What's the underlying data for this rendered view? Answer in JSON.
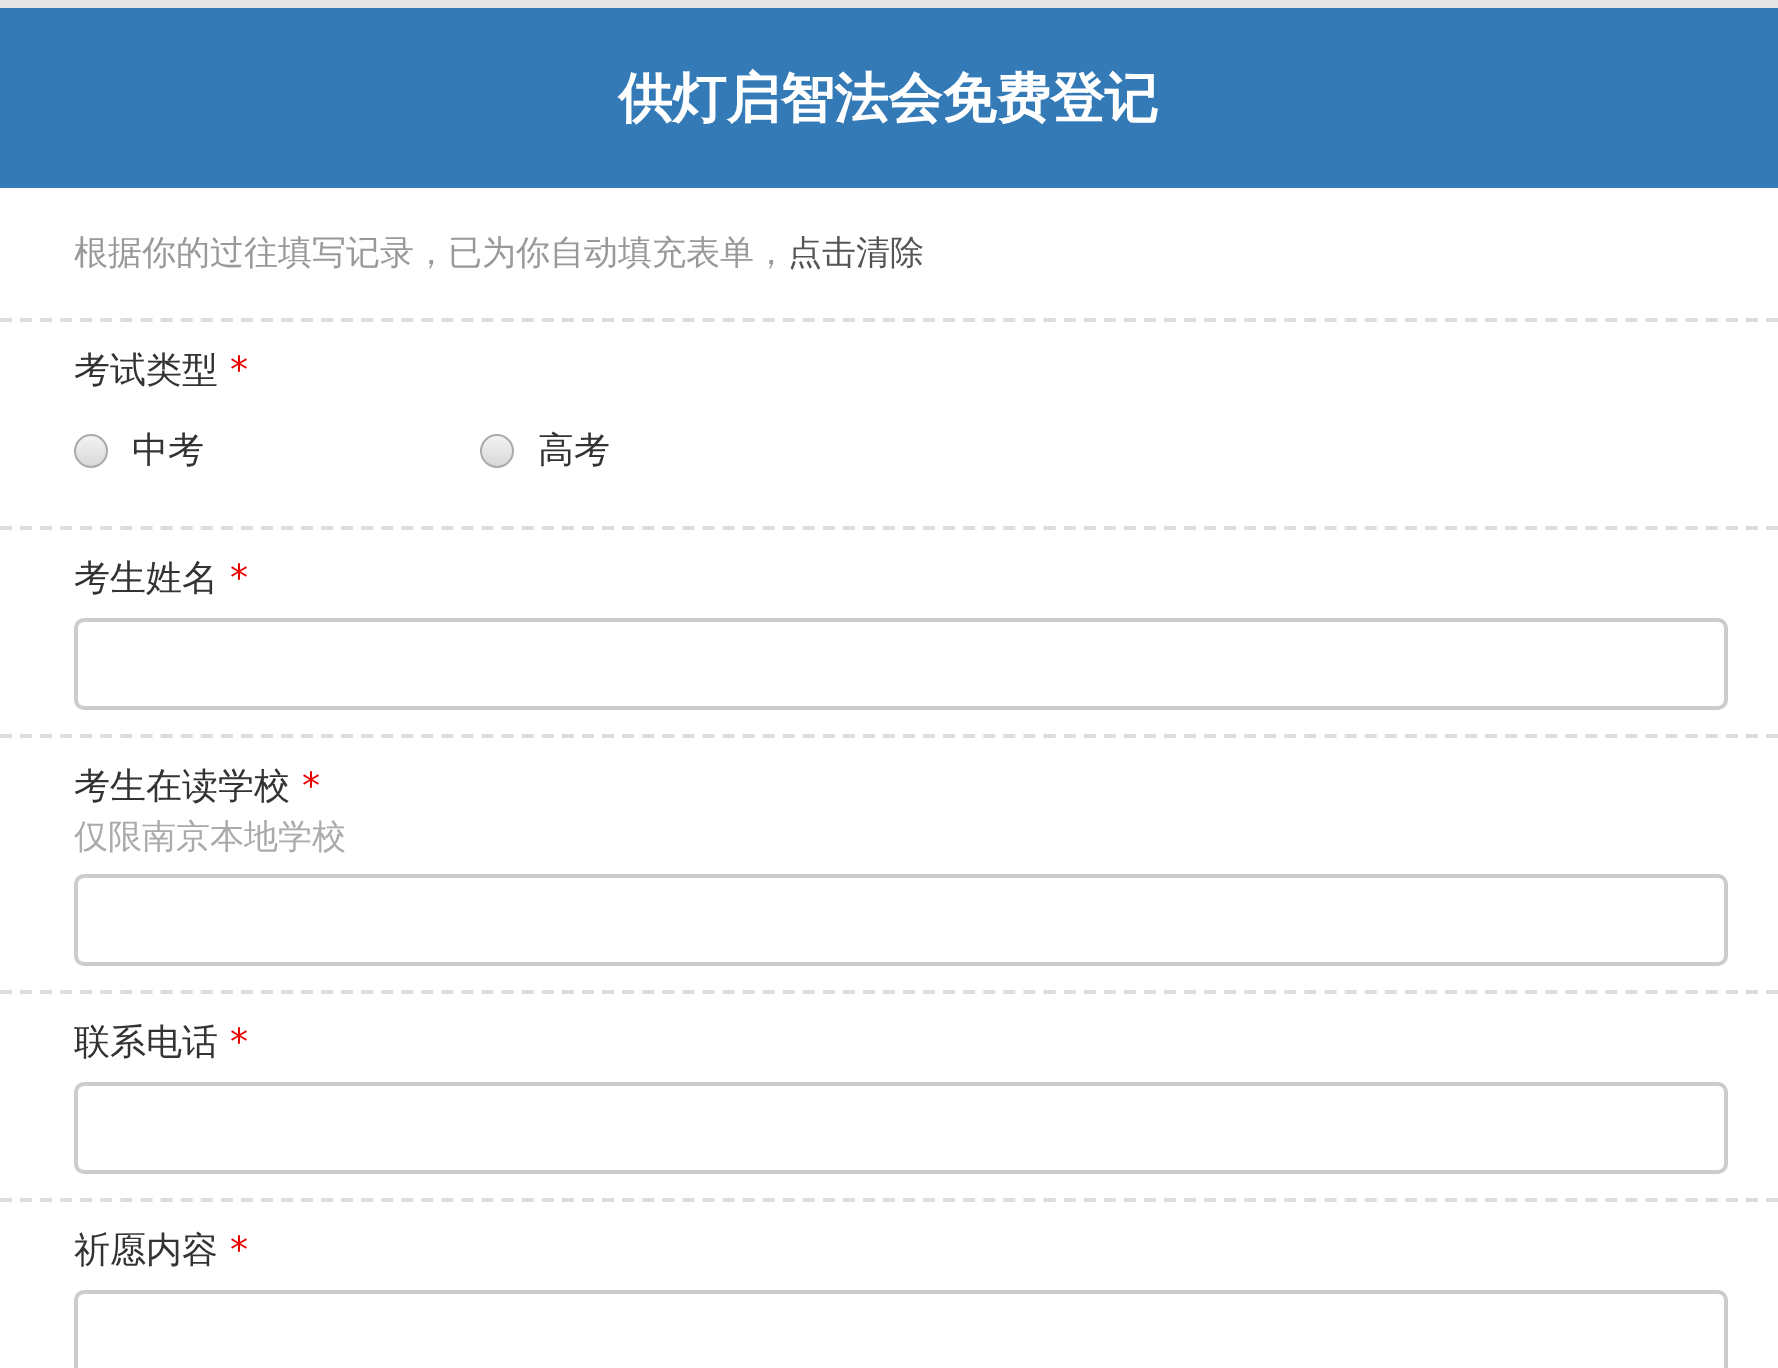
{
  "header": {
    "title": "供灯启智法会免费登记"
  },
  "notice": {
    "text": "根据你的过往填写记录，已为你自动填充表单，",
    "link": "点击清除"
  },
  "fields": [
    {
      "kind": "radio",
      "label": "考试类型",
      "required_mark": "*",
      "options": [
        {
          "label": "中考",
          "selected": false
        },
        {
          "label": "高考",
          "selected": false
        }
      ]
    },
    {
      "kind": "text",
      "label": "考生姓名",
      "required_mark": "*"
    },
    {
      "kind": "text",
      "label": "考生在读学校",
      "required_mark": "*",
      "hint": "仅限南京本地学校"
    },
    {
      "kind": "text",
      "label": "联系电话",
      "required_mark": "*"
    },
    {
      "kind": "text",
      "label": "祈愿内容",
      "required_mark": "*"
    }
  ]
}
